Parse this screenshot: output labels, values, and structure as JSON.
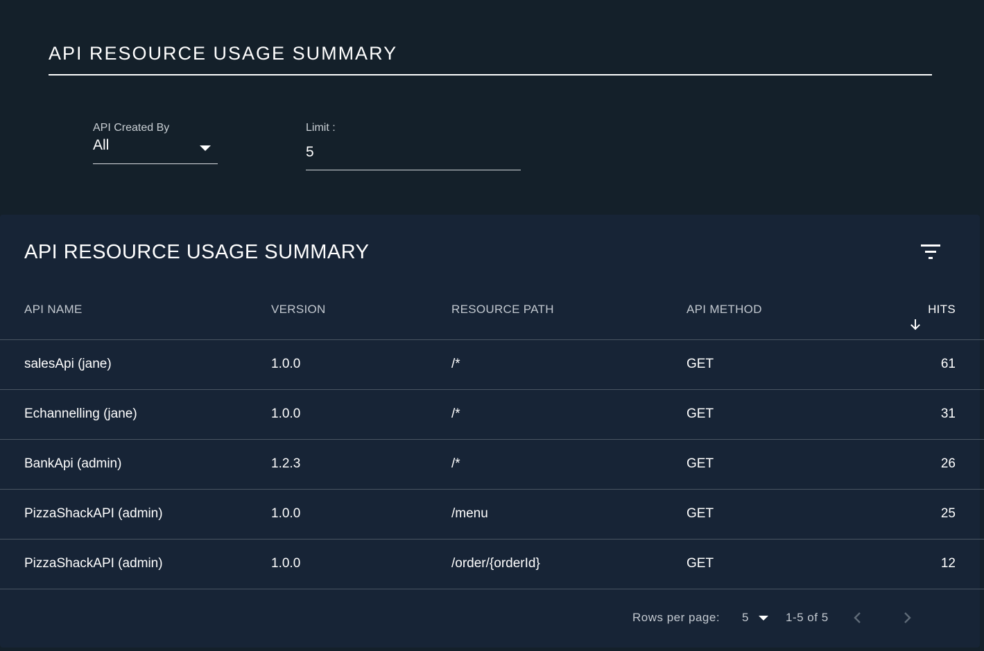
{
  "page": {
    "title": "API RESOURCE USAGE SUMMARY"
  },
  "filters": {
    "created_by": {
      "label": "API Created By",
      "value": "All"
    },
    "limit": {
      "label": "Limit :",
      "value": "5"
    }
  },
  "table": {
    "title": "API RESOURCE USAGE SUMMARY",
    "columns": {
      "api_name": "API NAME",
      "version": "VERSION",
      "resource_path": "RESOURCE PATH",
      "api_method": "API METHOD",
      "hits": "HITS"
    },
    "sort": {
      "column": "hits",
      "direction": "descending"
    },
    "rows": [
      {
        "api_name": "salesApi (jane)",
        "version": "1.0.0",
        "resource_path": "/*",
        "api_method": "GET",
        "hits": "61"
      },
      {
        "api_name": "Echannelling (jane)",
        "version": "1.0.0",
        "resource_path": "/*",
        "api_method": "GET",
        "hits": "31"
      },
      {
        "api_name": "BankApi (admin)",
        "version": "1.2.3",
        "resource_path": "/*",
        "api_method": "GET",
        "hits": "26"
      },
      {
        "api_name": "PizzaShackAPI (admin)",
        "version": "1.0.0",
        "resource_path": "/menu",
        "api_method": "GET",
        "hits": "25"
      },
      {
        "api_name": "PizzaShackAPI (admin)",
        "version": "1.0.0",
        "resource_path": "/order/{orderId}",
        "api_method": "GET",
        "hits": "12"
      }
    ]
  },
  "pagination": {
    "rows_per_page_label": "Rows per page:",
    "rows_per_page_value": "5",
    "range_text": "1-5 of 5"
  },
  "icons": {
    "filter": "filter-list-icon",
    "sort": "arrow-down-icon",
    "prev": "chevron-left-icon",
    "next": "chevron-right-icon"
  },
  "colors": {
    "page_background": "#14202a",
    "card_background": "#172436",
    "text_primary": "#ffffff",
    "text_secondary": "#c3c9d0",
    "divider": "#4b5663"
  }
}
